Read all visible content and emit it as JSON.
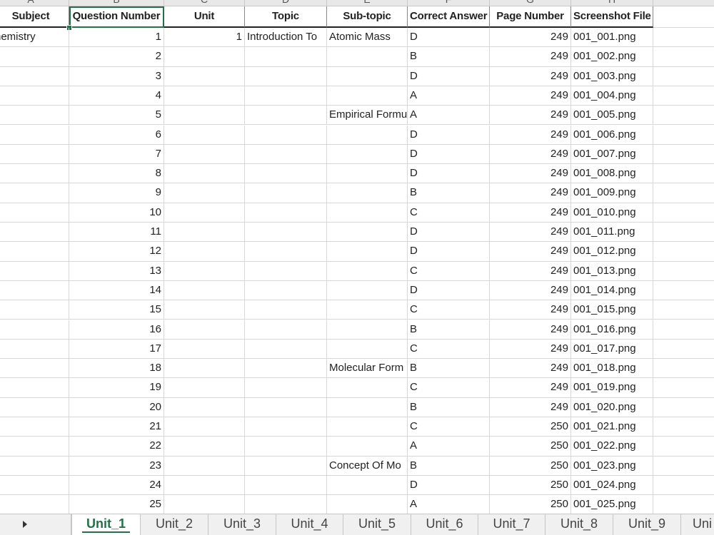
{
  "columns": [
    "A",
    "B",
    "C",
    "D",
    "E",
    "F",
    "G",
    "H"
  ],
  "headers": [
    "Subject",
    "Question Number",
    "Unit",
    "Topic",
    "Sub-topic",
    "Correct Answer",
    "Page Number",
    "Screenshot File"
  ],
  "rows": [
    [
      "hemistry",
      "1",
      "1",
      "Introduction To",
      "Atomic Mass",
      "D",
      "249",
      "001_001.png"
    ],
    [
      "",
      "2",
      "",
      "",
      "",
      "B",
      "249",
      "001_002.png"
    ],
    [
      "",
      "3",
      "",
      "",
      "",
      "D",
      "249",
      "001_003.png"
    ],
    [
      "",
      "4",
      "",
      "",
      "",
      "A",
      "249",
      "001_004.png"
    ],
    [
      "",
      "5",
      "",
      "",
      "Empirical Formu",
      "A",
      "249",
      "001_005.png"
    ],
    [
      "",
      "6",
      "",
      "",
      "",
      "D",
      "249",
      "001_006.png"
    ],
    [
      "",
      "7",
      "",
      "",
      "",
      "D",
      "249",
      "001_007.png"
    ],
    [
      "",
      "8",
      "",
      "",
      "",
      "D",
      "249",
      "001_008.png"
    ],
    [
      "",
      "9",
      "",
      "",
      "",
      "B",
      "249",
      "001_009.png"
    ],
    [
      "",
      "10",
      "",
      "",
      "",
      "C",
      "249",
      "001_010.png"
    ],
    [
      "",
      "11",
      "",
      "",
      "",
      "D",
      "249",
      "001_011.png"
    ],
    [
      "",
      "12",
      "",
      "",
      "",
      "D",
      "249",
      "001_012.png"
    ],
    [
      "",
      "13",
      "",
      "",
      "",
      "C",
      "249",
      "001_013.png"
    ],
    [
      "",
      "14",
      "",
      "",
      "",
      "D",
      "249",
      "001_014.png"
    ],
    [
      "",
      "15",
      "",
      "",
      "",
      "C",
      "249",
      "001_015.png"
    ],
    [
      "",
      "16",
      "",
      "",
      "",
      "B",
      "249",
      "001_016.png"
    ],
    [
      "",
      "17",
      "",
      "",
      "",
      "C",
      "249",
      "001_017.png"
    ],
    [
      "",
      "18",
      "",
      "",
      "Molecular Form",
      "B",
      "249",
      "001_018.png"
    ],
    [
      "",
      "19",
      "",
      "",
      "",
      "C",
      "249",
      "001_019.png"
    ],
    [
      "",
      "20",
      "",
      "",
      "",
      "B",
      "249",
      "001_020.png"
    ],
    [
      "",
      "21",
      "",
      "",
      "",
      "C",
      "250",
      "001_021.png"
    ],
    [
      "",
      "22",
      "",
      "",
      "",
      "A",
      "250",
      "001_022.png"
    ],
    [
      "",
      "23",
      "",
      "",
      "Concept Of Mo",
      "B",
      "250",
      "001_023.png"
    ],
    [
      "",
      "24",
      "",
      "",
      "",
      "D",
      "250",
      "001_024.png"
    ],
    [
      "",
      "25",
      "",
      "",
      "",
      "A",
      "250",
      "001_025.png"
    ]
  ],
  "sheet_tabs": [
    "Unit_1",
    "Unit_2",
    "Unit_3",
    "Unit_4",
    "Unit_5",
    "Unit_6",
    "Unit_7",
    "Unit_8",
    "Unit_9",
    "Uni"
  ],
  "active_tab": "Unit_1",
  "colors": {
    "accent": "#217346"
  }
}
